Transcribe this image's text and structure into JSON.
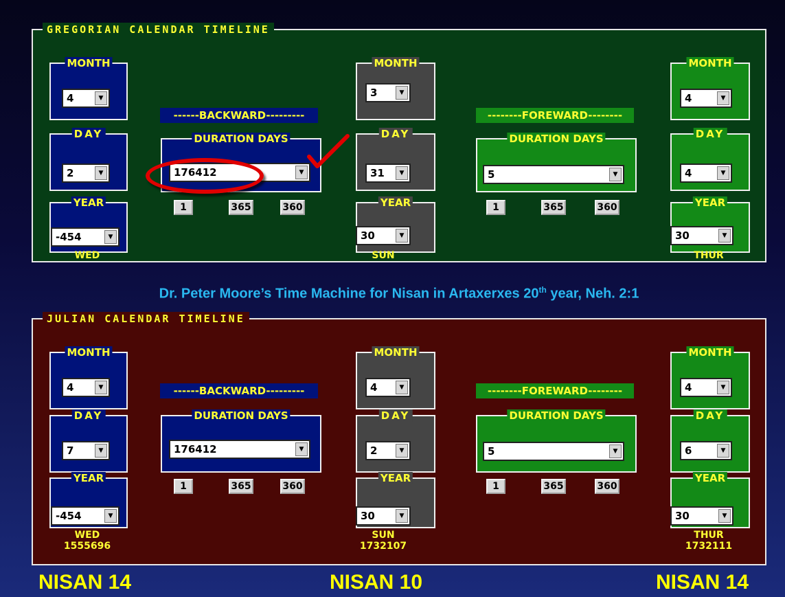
{
  "gregorian": {
    "title": "GREGORIAN CALENDAR TIMELINE",
    "left": {
      "month_label": "MONTH",
      "month": "4",
      "day_label": "DAY",
      "day": "2",
      "year_label": "YEAR",
      "year": "-454",
      "weekday": "WED"
    },
    "backward": {
      "strip_label": "------BACKWARD---------",
      "duration_label": "DURATION DAYS",
      "duration": "176412",
      "buttons": [
        "1",
        "365",
        "360"
      ]
    },
    "middle": {
      "month_label": "MONTH",
      "month": "3",
      "day_label": "DAY",
      "day": "31",
      "year_label": "YEAR",
      "year": "30",
      "weekday": "SUN"
    },
    "forward": {
      "strip_label": "--------FOREWARD--------",
      "duration_label": "DURATION DAYS",
      "duration": "5",
      "buttons": [
        "1",
        "365",
        "360"
      ]
    },
    "right": {
      "month_label": "MONTH",
      "month": "4",
      "day_label": "DAY",
      "day": "4",
      "year_label": "YEAR",
      "year": "30",
      "weekday": "THUR"
    }
  },
  "caption": {
    "main": "Dr. Peter Moore’s Time Machine for Nisan in Artaxerxes 20",
    "sup": "th",
    "tail": " year, Neh. 2:1"
  },
  "julian": {
    "title": "JULIAN CALENDAR TIMELINE",
    "left": {
      "month_label": "MONTH",
      "month": "4",
      "day_label": "DAY",
      "day": "7",
      "year_label": "YEAR",
      "year": "-454",
      "weekday": "WED",
      "jdn": "1555696"
    },
    "backward": {
      "strip_label": "------BACKWARD---------",
      "duration_label": "DURATION DAYS",
      "duration": "176412",
      "buttons": [
        "1",
        "365",
        "360"
      ]
    },
    "middle": {
      "month_label": "MONTH",
      "month": "4",
      "day_label": "DAY",
      "day": "2",
      "year_label": "YEAR",
      "year": "30",
      "weekday": "SUN",
      "jdn": "1732107"
    },
    "forward": {
      "strip_label": "--------FOREWARD--------",
      "duration_label": "DURATION DAYS",
      "duration": "5",
      "buttons": [
        "1",
        "365",
        "360"
      ]
    },
    "right": {
      "month_label": "MONTH",
      "month": "4",
      "day_label": "DAY",
      "day": "6",
      "year_label": "YEAR",
      "year": "30",
      "weekday": "THUR",
      "jdn": "1732111"
    }
  },
  "nisan_labels": [
    "NISAN 14",
    "NISAN 10",
    "NISAN 14"
  ],
  "colors": {
    "highlight_circle": "#e00000",
    "checkmark": "#e00000",
    "label_text": "#ffff33",
    "caption": "#2ab8f0"
  }
}
